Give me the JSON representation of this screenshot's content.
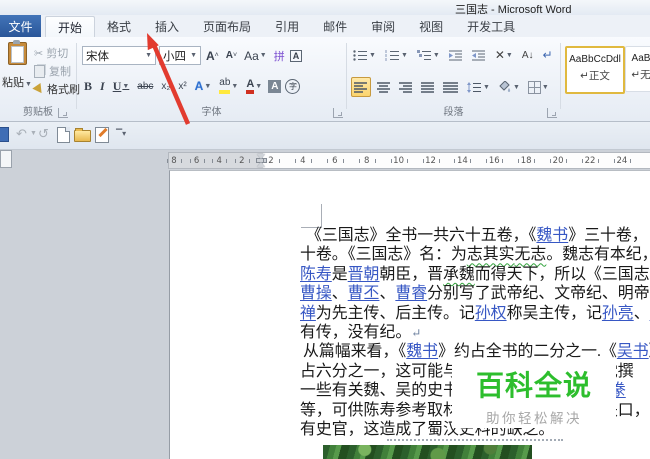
{
  "window": {
    "title": "三国志 - Microsoft Word"
  },
  "tabs": {
    "file": "文件",
    "active_index": 0,
    "items": [
      "开始",
      "格式",
      "插入",
      "页面布局",
      "引用",
      "邮件",
      "审阅",
      "视图",
      "开发工具"
    ]
  },
  "ribbon": {
    "clipboard": {
      "group": "剪贴板",
      "paste": "粘贴",
      "cut": "剪切",
      "copy": "复制",
      "painter": "格式刷"
    },
    "font": {
      "group": "字体",
      "name": "宋体",
      "size": "小四",
      "grow": "A",
      "shrink": "A",
      "case": "Aa",
      "phonetic": "拼",
      "char_border": "A",
      "bold": "B",
      "italic": "I",
      "underline": "U",
      "strike": "abc",
      "sub": "x₂",
      "sup": "x²",
      "effects": "A",
      "highlight": "ab",
      "color": "A",
      "char_shading": "A",
      "enclose": "字"
    },
    "paragraph": {
      "group": "段落",
      "sort": "A↓",
      "pilcrow": "↵"
    },
    "styles": {
      "cards": [
        {
          "sample": "AaBbCcDdl",
          "name": "↵正文",
          "selected": true
        },
        {
          "sample": "AaB",
          "name": "↵无",
          "selected": false
        }
      ]
    }
  },
  "ruler": {
    "left_numbers": [
      "8",
      "6",
      "4",
      "2"
    ],
    "right_numbers": [
      "2",
      "4",
      "6",
      "8",
      "10",
      "12",
      "14",
      "16",
      "18",
      "20",
      "22",
      "24"
    ]
  },
  "document": {
    "lines": [
      {
        "ind": 6,
        "segs": [
          {
            "t": "《三国志》全书一共六十五卷，《"
          },
          {
            "t": "魏书",
            "s": "link"
          },
          {
            "t": "》三十卷，"
          }
        ]
      },
      {
        "ind": 0,
        "segs": [
          {
            "t": "十卷。《三国志》名：为"
          },
          {
            "t": "志其实",
            "s": "wavy"
          },
          {
            "t": "无志",
            "s": "wavy"
          },
          {
            "t": "。魏志有本纪，"
          }
        ]
      },
      {
        "ind": 0,
        "segs": [
          {
            "t": "陈寿",
            "s": "link"
          },
          {
            "t": "是"
          },
          {
            "t": "晋朝",
            "s": "link"
          },
          {
            "t": "朝臣，晋"
          },
          {
            "t": "承魏",
            "s": "wavy"
          },
          {
            "t": "而得天下，所以《三国志》"
          }
        ]
      },
      {
        "ind": 0,
        "segs": [
          {
            "t": "曹操",
            "s": "link"
          },
          {
            "t": "、"
          },
          {
            "t": "曹丕",
            "s": "link"
          },
          {
            "t": "、"
          },
          {
            "t": "曹睿",
            "s": "link"
          },
          {
            "t": "分别写了武帝纪、文帝纪、明帝纪"
          }
        ]
      },
      {
        "ind": 0,
        "segs": [
          {
            "t": "禅",
            "s": "link"
          },
          {
            "t": "为先主传、后主传。记"
          },
          {
            "t": "孙权",
            "s": "link"
          },
          {
            "t": "称吴主传，记"
          },
          {
            "t": "孙亮",
            "s": "link"
          },
          {
            "t": "、"
          },
          {
            "t": "孙休",
            "s": "link"
          }
        ]
      },
      {
        "ind": 0,
        "segs": [
          {
            "t": "有传，没有纪。"
          },
          {
            "t": "↵",
            "s": "mark"
          }
        ]
      },
      {
        "ind": 3,
        "segs": [
          {
            "t": "从篇幅来看，《"
          },
          {
            "t": "魏书",
            "s": "link"
          },
          {
            "t": "》约占全书的二分之一.《"
          },
          {
            "t": "吴书",
            "s": "link"
          },
          {
            "t": "》"
          }
        ]
      },
      {
        "ind": 0,
        "segs": [
          {
            "t": "占六分之一，这可能与史料的多少有关。王沈撰"
          }
        ]
      },
      {
        "ind": 0,
        "segs": [
          {
            "t": "一些有关魏、吴的史书，如王沈《魏书》、"
          },
          {
            "t": "鱼豢",
            "s": "link"
          }
        ]
      },
      {
        "ind": 0,
        "segs": [
          {
            "t": "等，可供陈寿参考取材。而蜀汉无史官记载缺口，而"
          }
        ]
      },
      {
        "ind": 0,
        "segs": [
          {
            "t": "有史官，这造成了蜀汉史料的缺乏。"
          }
        ]
      }
    ],
    "watermark": {
      "title": "百科全说",
      "subtitle": "助你轻松解决"
    }
  },
  "colors": {
    "link": "#3757c4",
    "wavy_underline": "#33a33d",
    "watermark_green": "#2dbe2d",
    "file_tab_blue": "#2f5fa3",
    "arrow_red": "#e23b2f",
    "selection_gold": "#fbd46d"
  }
}
